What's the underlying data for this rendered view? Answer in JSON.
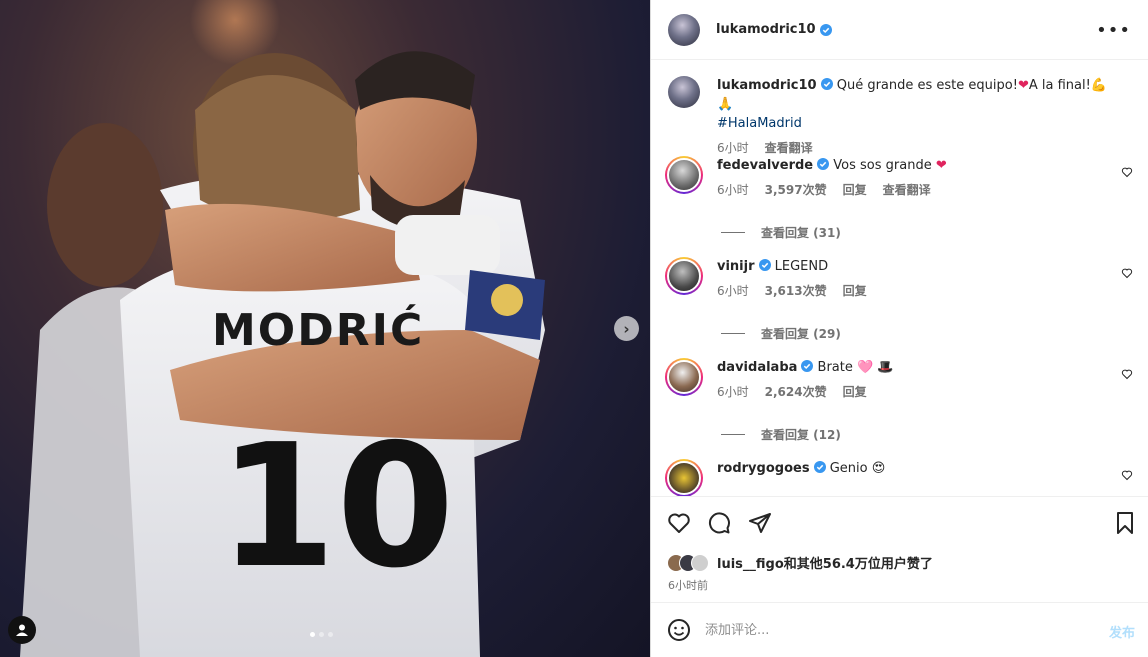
{
  "post": {
    "author": "lukamodric10",
    "image_alt": "",
    "carousel": {
      "slides": 3,
      "active": 1
    }
  },
  "header": {
    "username": "lukamodric10",
    "more_icon": "more-horizontal-icon"
  },
  "caption": {
    "username": "lukamodric10",
    "text": "Qué grande es este equipo!",
    "text2": "A la final!",
    "hashtag": "#HalaMadrid",
    "time": "6小时",
    "translate": "查看翻译"
  },
  "comments": [
    {
      "username": "fedevalverde",
      "text": "Vos sos grande",
      "emoji": "❤",
      "time": "6小时",
      "likes": "3,597次赞",
      "reply": "回复",
      "translate": "查看翻译",
      "view_replies": "查看回复 (31)"
    },
    {
      "username": "vinijr",
      "text": "LEGEND",
      "emoji": "",
      "time": "6小时",
      "likes": "3,613次赞",
      "reply": "回复",
      "translate": "",
      "view_replies": "查看回复 (29)"
    },
    {
      "username": "davidalaba",
      "text": "Brate 🩷",
      "emoji": "🎩",
      "time": "6小时",
      "likes": "2,624次赞",
      "reply": "回复",
      "translate": "",
      "view_replies": "查看回复 (12)"
    },
    {
      "username": "rodrygogoes",
      "text": "Genio",
      "emoji": "😍",
      "time": "",
      "likes": "",
      "reply": "",
      "translate": "",
      "view_replies": ""
    }
  ],
  "actions": {
    "like_icon": "heart-icon",
    "comment_icon": "comment-icon",
    "share_icon": "send-icon",
    "save_icon": "bookmark-icon",
    "likes_text": "luis__figo和其他56.4万位用户赞了",
    "time_ago": "6小时前"
  },
  "composer": {
    "emoji_icon": "smiley-icon",
    "placeholder": "添加评论...",
    "post_label": "发布"
  },
  "colors": {
    "verified": "#3897f0",
    "link": "#00376b",
    "post_disabled": "#b2dffc",
    "muted": "#737373"
  }
}
